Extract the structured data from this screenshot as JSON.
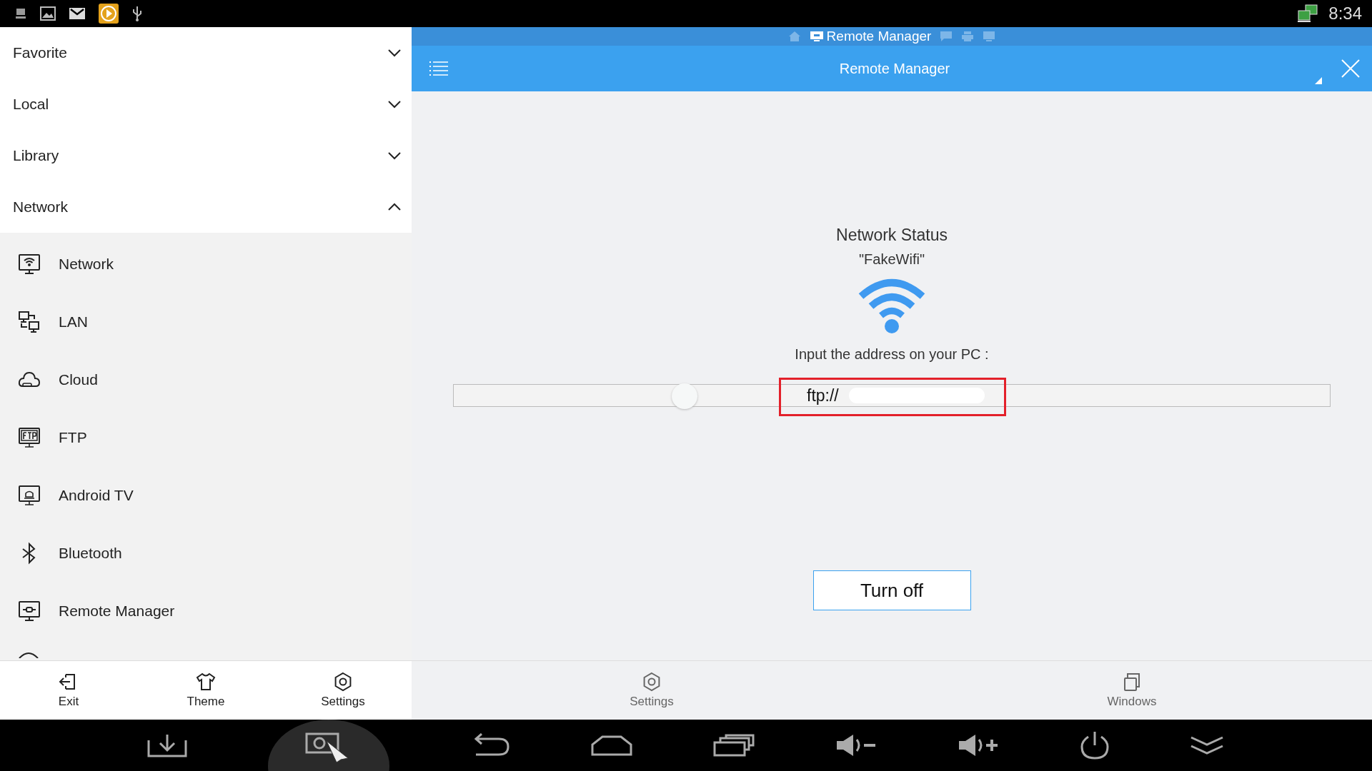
{
  "status_bar": {
    "time": "8:34"
  },
  "sidebar": {
    "sections": [
      {
        "label": "Favorite",
        "expanded": false
      },
      {
        "label": "Local",
        "expanded": false
      },
      {
        "label": "Library",
        "expanded": false
      },
      {
        "label": "Network",
        "expanded": true
      }
    ],
    "items": [
      {
        "label": "Network"
      },
      {
        "label": "LAN"
      },
      {
        "label": "Cloud"
      },
      {
        "label": "FTP"
      },
      {
        "label": "Android TV"
      },
      {
        "label": "Bluetooth"
      },
      {
        "label": "Remote Manager"
      }
    ],
    "toolbar": [
      "Exit",
      "Theme",
      "Settings"
    ]
  },
  "breadcrumb": {
    "current": "Remote Manager"
  },
  "header": {
    "title": "Remote Manager"
  },
  "content": {
    "heading": "Network Status",
    "ssid": "\"FakeWifi\"",
    "prompt": "Input the address on your PC :",
    "address": "ftp://",
    "button": "Turn off"
  },
  "toolbar": [
    "Settings",
    "Windows"
  ]
}
